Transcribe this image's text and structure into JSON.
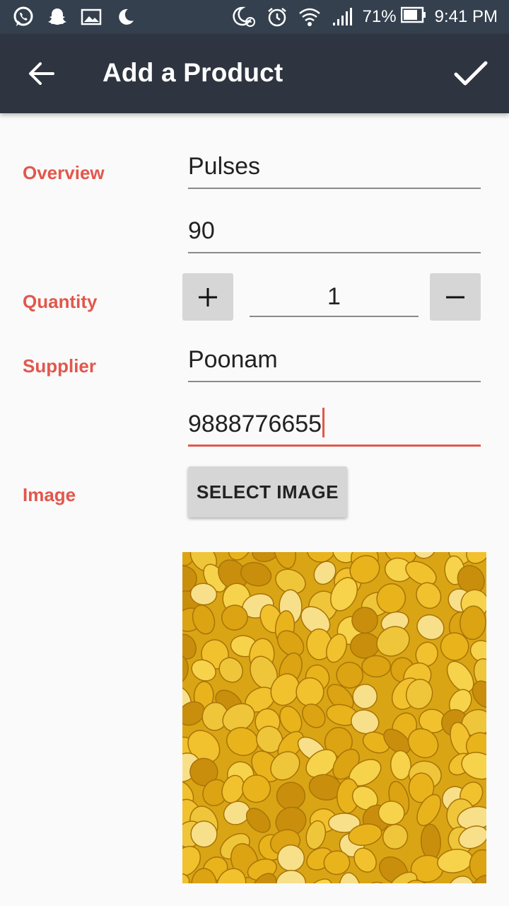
{
  "status_bar": {
    "left_icons": [
      "whatsapp-icon",
      "snapchat-icon",
      "gallery-icon",
      "moon-icon"
    ],
    "right_icons": [
      "do-not-disturb-icon",
      "alarm-icon",
      "wifi-icon",
      "signal-icon"
    ],
    "battery": "71%",
    "time": "9:41 PM"
  },
  "app_bar": {
    "title": "Add a Product",
    "back_icon": "arrow-back-icon",
    "confirm_icon": "check-icon"
  },
  "form": {
    "overview_label": "Overview",
    "product_name": "Pulses",
    "price": "90",
    "quantity_label": "Quantity",
    "quantity_increase": "+",
    "quantity_value": "1",
    "quantity_decrease": "−",
    "supplier_label": "Supplier",
    "supplier_name": "Poonam",
    "supplier_phone": "9888776655",
    "image_label": "Image",
    "select_image_button": "SELECT IMAGE"
  },
  "image": {
    "description_icon": "product-photo",
    "accent_color": "#e2574c"
  }
}
